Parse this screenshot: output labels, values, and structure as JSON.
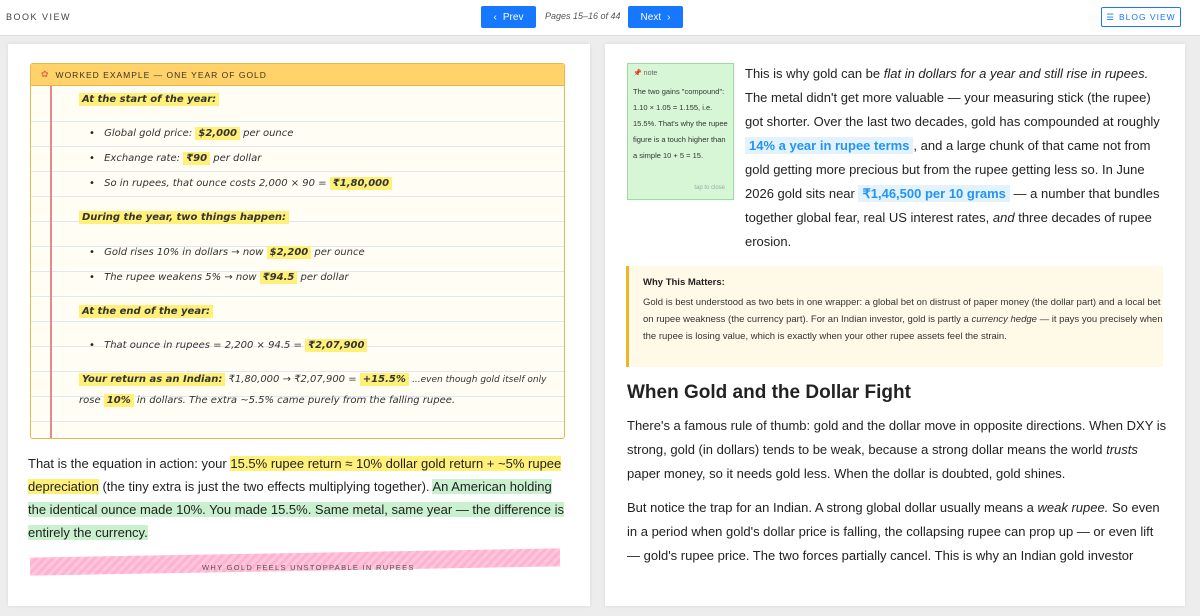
{
  "toolbar": {
    "book_view": "BOOK VIEW",
    "prev": "Prev",
    "pages": "Pages 15–16 of 44",
    "next": "Next",
    "blog_view": "BLOG VIEW"
  },
  "left_page": {
    "example": {
      "header": "WORKED EXAMPLE — ONE YEAR OF GOLD",
      "start_heading": "At the start of the year:",
      "gold_label": "Global gold price:",
      "gold_value": "$2,000",
      "gold_unit": "per ounce",
      "fx_label": "Exchange rate:",
      "fx_value": "₹90",
      "fx_unit": "per dollar",
      "rupees_label": "So in rupees, that ounce costs 2,000 × 90 =",
      "rupees_value": "₹1,80,000",
      "during_heading": "During the year, two things happen:",
      "rise_label": "Gold rises 10% in dollars → now",
      "rise_value": "$2,200",
      "rise_unit": "per ounce",
      "weak_label": "The rupee weakens 5% → now",
      "weak_value": "₹94.5",
      "weak_unit": "per dollar",
      "end_heading": "At the end of the year:",
      "end_label": "That ounce in rupees = 2,200 × 94.5 =",
      "end_value": "₹2,07,900",
      "return_label": "Your return as an Indian:",
      "return_calc": "₹1,80,000 → ₹2,07,900 =",
      "return_value": "+15.5%",
      "return_tail": "...even though gold itself only",
      "rose_label": "rose",
      "rose_value": "10%",
      "rose_tail": "in dollars. The extra ~5.5% came purely from the falling rupee."
    },
    "prose_intro": "That is the equation in action: your",
    "prose_highlight_1": "15.5% rupee return ≈ 10% dollar gold return + ~5% rupee depreciation",
    "prose_mid": "(the tiny extra is just the two effects multiplying together).",
    "prose_highlight_2": "An American holding the identical ounce made 10%. You made 15.5%. Same metal, same year — the difference is entirely the currency.",
    "footer_label": "WHY GOLD FEELS UNSTOPPABLE IN RUPEES"
  },
  "right_page": {
    "note": {
      "label": "note",
      "body": "The two gains \"compound\": 1.10 × 1.05 = 1.155, i.e. 15.5%. That's why the rupee figure is a touch higher than a simple 10 + 5 = 15.",
      "tap": "tap to close"
    },
    "para1_a": "This is why gold can be",
    "para1_em": "flat in dollars for a year and still rise in rupees.",
    "para1_b": "The metal didn't get more valuable — your measuring stick (the rupee) got shorter. Over the last two decades, gold has compounded at roughly",
    "para1_hl": "14% a year in rupee terms",
    "para1_c": ", and a large chunk of that came not from gold getting more precious but from the rupee getting less so. In June 2026 gold sits near",
    "para1_hl2": "₹1,46,500 per 10 grams",
    "para1_d": "— a number that bundles together global fear, real US interest rates,",
    "para1_em2": "and",
    "para1_e": "three decades of rupee erosion.",
    "callout_title": "Why This Matters:",
    "callout_a": "Gold is best understood as two bets in one wrapper: a global bet on distrust of paper money (the dollar part) and a local bet on rupee weakness (the currency part). For an Indian investor, gold is partly a",
    "callout_em": "currency hedge",
    "callout_b": "— it pays you precisely when the rupee is losing value, which is exactly when your other rupee assets feel the strain.",
    "heading": "When Gold and the Dollar Fight",
    "para2_a": "There's a famous rule of thumb: gold and the dollar move in opposite directions. When DXY is strong, gold (in dollars) tends to be weak, because a strong dollar means the world",
    "para2_em": "trusts",
    "para2_b": "paper money, so it needs gold less. When the dollar is doubted, gold shines.",
    "para3_a": "But notice the trap for an Indian. A strong global dollar usually means a",
    "para3_em": "weak rupee.",
    "para3_b": "So even in a period when gold's dollar price is falling, the collapsing rupee can prop up — or even lift — gold's rupee price. The two forces partially cancel. This is why an Indian gold investor"
  }
}
